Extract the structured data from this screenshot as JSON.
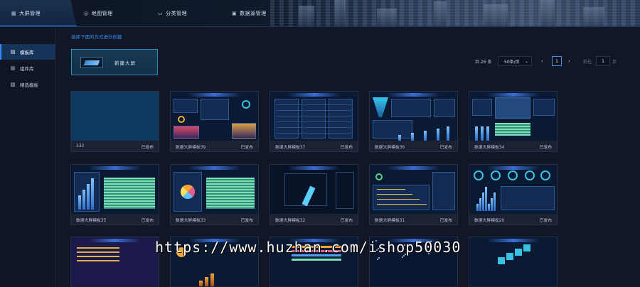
{
  "nav": {
    "active_tab": "大屏管理",
    "tabs": [
      "地图管理",
      "分类管理",
      "数据源管理"
    ]
  },
  "sidebar": {
    "items": [
      {
        "label": "模板库",
        "icon": "template-icon",
        "active": true
      },
      {
        "label": "组件库",
        "icon": "component-icon",
        "active": false
      },
      {
        "label": "精选模板",
        "icon": "star-template-icon",
        "active": false
      }
    ]
  },
  "main": {
    "hint": "选择下面的方式进行创建",
    "new_label": "新建大屏"
  },
  "pagination": {
    "total": "共 26 条",
    "page_size": "50条/页",
    "current": "1",
    "goto_label": "前往",
    "goto_value": "1",
    "goto_suffix": "页"
  },
  "cards": [
    {
      "name": "333",
      "status": "已发布",
      "style": "blank"
    },
    {
      "name": "数据大屏模板39",
      "status": "已发布",
      "style": "mixed"
    },
    {
      "name": "数据大屏模板37",
      "status": "已发布",
      "style": "table"
    },
    {
      "name": "数据大屏模板36",
      "status": "已发布",
      "style": "funnel"
    },
    {
      "name": "数据大屏模板34",
      "status": "已发布",
      "style": "map"
    },
    {
      "name": "数据大屏模板35",
      "status": "已发布",
      "style": "bars"
    },
    {
      "name": "数据大屏模板33",
      "status": "已发布",
      "style": "pie"
    },
    {
      "name": "数据大屏模板32",
      "status": "已发布",
      "style": "dark"
    },
    {
      "name": "数据大屏模板31",
      "status": "已发布",
      "style": "gantt"
    },
    {
      "name": "数据大屏模板20",
      "status": "已发布",
      "style": "gauges"
    },
    {
      "name": "",
      "status": "",
      "style": "purple"
    },
    {
      "name": "",
      "status": "",
      "style": "orange"
    },
    {
      "name": "",
      "status": "",
      "style": "rows"
    },
    {
      "name": "",
      "status": "",
      "style": "starfield"
    },
    {
      "name": "",
      "status": "",
      "style": "steps"
    }
  ],
  "watermark": "https://www.huzhan.com/ishop50030",
  "colors": {
    "accent": "#2f8fff",
    "background": "#111726",
    "card": "#1a2233",
    "hint": "#3f8ff5"
  }
}
